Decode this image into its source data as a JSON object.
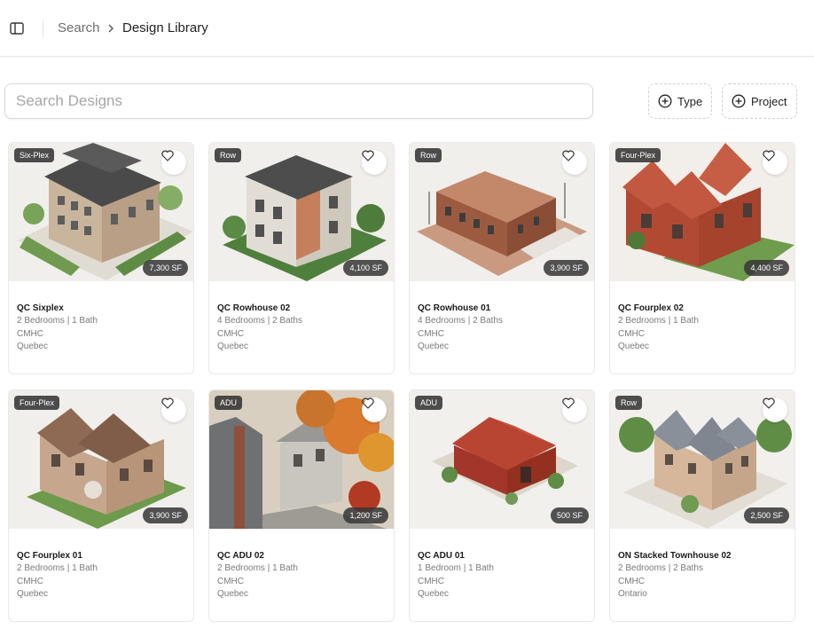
{
  "breadcrumb": {
    "root": "Search",
    "current": "Design Library"
  },
  "search": {
    "placeholder": "Search Designs",
    "value": ""
  },
  "filters": [
    {
      "label": "Type"
    },
    {
      "label": "Project"
    }
  ],
  "colors": {
    "accent": "#222222",
    "badge_bg": "#2b2b2b",
    "border": "#e6e6e6"
  },
  "cards": [
    {
      "type": "Six-Plex",
      "area": "7,300 SF",
      "title": "QC Sixplex",
      "rooms": "2 Bedrooms | 1 Bath",
      "program": "CMHC",
      "region": "Quebec",
      "icon": "heart-icon"
    },
    {
      "type": "Row",
      "area": "4,100 SF",
      "title": "QC Rowhouse 02",
      "rooms": "4 Bedrooms | 2 Baths",
      "program": "CMHC",
      "region": "Quebec",
      "icon": "heart-icon"
    },
    {
      "type": "Row",
      "area": "3,900 SF",
      "title": "QC Rowhouse 01",
      "rooms": "4 Bedrooms | 2 Baths",
      "program": "CMHC",
      "region": "Quebec",
      "icon": "heart-icon"
    },
    {
      "type": "Four-Plex",
      "area": "4,400 SF",
      "title": "QC Fourplex 02",
      "rooms": "2 Bedrooms | 1 Bath",
      "program": "CMHC",
      "region": "Quebec",
      "icon": "heart-icon"
    },
    {
      "type": "Four-Plex",
      "area": "3,900 SF",
      "title": "QC Fourplex 01",
      "rooms": "2 Bedrooms | 1 Bath",
      "program": "CMHC",
      "region": "Quebec",
      "icon": "heart-icon"
    },
    {
      "type": "ADU",
      "area": "1,200 SF",
      "title": "QC ADU 02",
      "rooms": "2 Bedrooms | 1 Bath",
      "program": "CMHC",
      "region": "Quebec",
      "icon": "heart-icon"
    },
    {
      "type": "ADU",
      "area": "500 SF",
      "title": "QC ADU 01",
      "rooms": "1 Bedroom | 1 Bath",
      "program": "CMHC",
      "region": "Quebec",
      "icon": "heart-icon"
    },
    {
      "type": "Row",
      "area": "2,500 SF",
      "title": "ON Stacked Townhouse 02",
      "rooms": "2 Bedrooms | 2 Baths",
      "program": "CMHC",
      "region": "Ontario",
      "icon": "heart-icon"
    }
  ]
}
